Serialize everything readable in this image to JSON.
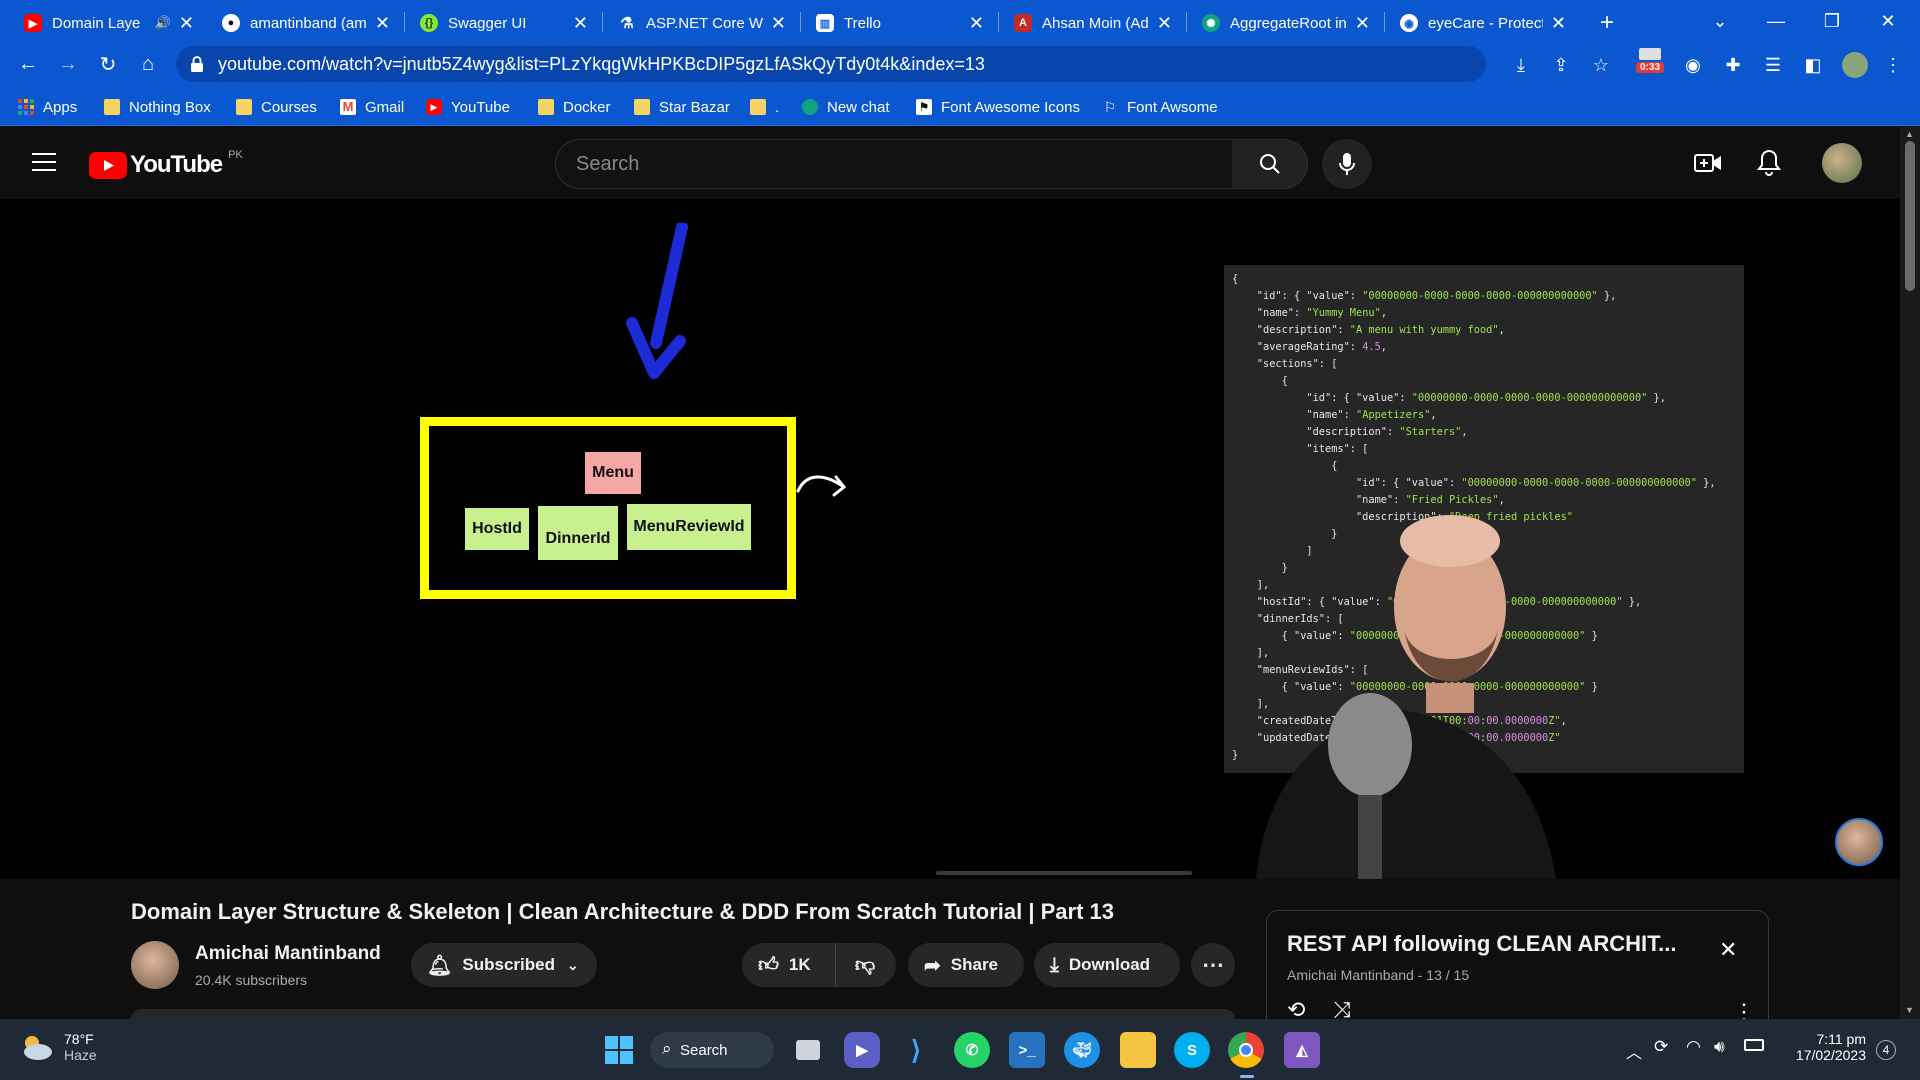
{
  "browser": {
    "tabs": [
      {
        "title": "Domain Laye",
        "favicon": "youtube-favicon",
        "active": true
      },
      {
        "title": "amantinband (am",
        "favicon": "github-favicon"
      },
      {
        "title": "Swagger UI",
        "favicon": "swagger-favicon"
      },
      {
        "title": "ASP.NET Core We",
        "favicon": "dotnet-favicon"
      },
      {
        "title": "Trello",
        "favicon": "trello-favicon"
      },
      {
        "title": "Ahsan Moin (Adm",
        "favicon": "profile-favicon"
      },
      {
        "title": "AggregateRoot in",
        "favicon": "chatgpt-favicon"
      },
      {
        "title": "eyeCare - Protect",
        "favicon": "eyecare-favicon"
      }
    ],
    "new_tab_label": "+",
    "url": "youtube.com/watch?v=jnutb5Z4wyg&list=PLzYkqgWkHPKBcDIP5gzLfASkQyTdy0t4k&index=13",
    "extension_badge": "0:33",
    "bookmarks": [
      {
        "label": "Apps",
        "icon": "apps-grid-icon"
      },
      {
        "label": "Nothing Box",
        "icon": "folder-icon"
      },
      {
        "label": "Courses",
        "icon": "folder-icon"
      },
      {
        "label": "Gmail",
        "icon": "gmail-icon"
      },
      {
        "label": "YouTube",
        "icon": "youtube-icon"
      },
      {
        "label": "Docker",
        "icon": "folder-icon"
      },
      {
        "label": "Star Bazar",
        "icon": "folder-icon"
      },
      {
        "label": ".",
        "icon": "folder-icon"
      },
      {
        "label": "New chat",
        "icon": "chatgpt-icon"
      },
      {
        "label": "Font Awesome Icons",
        "icon": "flag-icon"
      },
      {
        "label": "Font Awsome",
        "icon": "flag-outline-icon"
      }
    ]
  },
  "youtube": {
    "logo_text": "YouTube",
    "country_code": "PK",
    "search_placeholder": "Search"
  },
  "video_slide": {
    "notes": [
      "Menu",
      "HostId",
      "DinnerId",
      "MenuReviewId"
    ],
    "code_lines": [
      "{",
      "    \"id\": { \"value\": \"00000000-0000-0000-0000-000000000000\" },",
      "    \"name\": \"Yummy Menu\",",
      "    \"description\": \"A menu with yummy food\",",
      "    \"averageRating\": 4.5,",
      "    \"sections\": [",
      "        {",
      "            \"id\": { \"value\": \"00000000-0000-0000-0000-000000000000\" },",
      "            \"name\": \"Appetizers\",",
      "            \"description\": \"Starters\",",
      "            \"items\": [",
      "                {",
      "                    \"id\": { \"value\": \"00000000-0000-0000-0000-000000000000\" },",
      "                    \"name\": \"Fried Pickles\",",
      "                    \"description\": \"Deep fried pickles\"",
      "                }",
      "            ]",
      "        }",
      "    ],",
      "    \"hostId\": { \"value\": \"00000000-0000-0000-0000-000000000000\" },",
      "    \"dinnerIds\": [",
      "        { \"value\": \"00000000-0000-0000-0000-000000000000\" }",
      "    ],",
      "    \"menuReviewIds\": [",
      "        { \"value\": \"00000000-0000-0000-0000-000000000000\" }",
      "    ],",
      "    \"createdDateTime\": \"2020-01-01T00:00:00.0000000Z\",",
      "    \"updatedDateTime\": \"2020-01-01T00:00:00.0000000Z\"",
      "}"
    ]
  },
  "video_meta": {
    "title": "Domain Layer Structure & Skeleton | Clean Architecture & DDD From Scratch Tutorial | Part 13",
    "channel_name": "Amichai Mantinband",
    "subscribers": "20.4K subscribers",
    "subscribe_label": "Subscribed",
    "like_count": "1K",
    "share_label": "Share",
    "download_label": "Download"
  },
  "playlist": {
    "title": "REST API following CLEAN ARCHIT...",
    "subtitle": "Amichai Mantinband - 13 / 15"
  },
  "taskbar": {
    "weather_temp": "78°F",
    "weather_desc": "Haze",
    "search_label": "Search",
    "time": "7:11 pm",
    "date": "17/02/2023",
    "notification_count": "4"
  },
  "colors": {
    "chrome_blue": "#0b57d0",
    "youtube_red": "#ff0000",
    "note_green": "#c8f08f",
    "note_pink": "#f7a6a6",
    "highlight_yellow": "#ffff00",
    "arrow_blue": "#1d2bd6"
  }
}
